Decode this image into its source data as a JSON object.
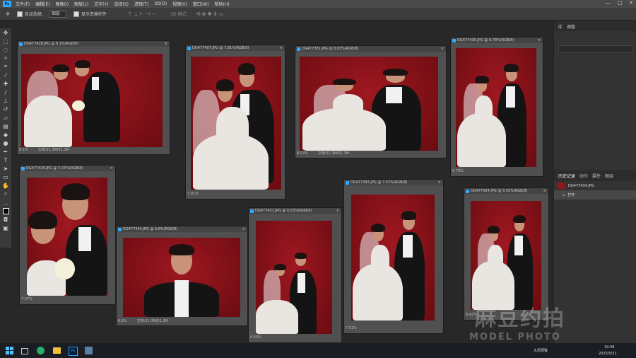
{
  "menubar": {
    "logo": "Ps",
    "items": [
      "文件(F)",
      "编辑(E)",
      "图像(I)",
      "图层(L)",
      "文字(Y)",
      "选择(S)",
      "滤镜(T)",
      "3D(D)",
      "视图(V)",
      "窗口(W)",
      "帮助(H)"
    ],
    "window_controls": [
      "—",
      "□",
      "✕"
    ]
  },
  "options_bar": {
    "auto_select_label": "自动选择：",
    "auto_select_value": "图层",
    "show_transform_label": "显示变换控件",
    "mode_label": "3D 模式："
  },
  "tools": [
    "move-icon",
    "marquee-icon",
    "lasso-icon",
    "magic-wand-icon",
    "crop-icon",
    "eyedropper-icon",
    "healing-icon",
    "brush-icon",
    "stamp-icon",
    "history-brush-icon",
    "eraser-icon",
    "gradient-icon",
    "blur-icon",
    "dodge-icon",
    "pen-icon",
    "type-icon",
    "path-select-icon",
    "rectangle-icon",
    "hand-icon",
    "zoom-icon",
    "more-icon",
    "color-swatch-icon",
    "quickmask-icon",
    "screenmode-icon"
  ],
  "right_panel": {
    "top_tabs": [
      "库",
      "调整"
    ],
    "history_tabs": [
      "历史记录",
      "动作",
      "属性",
      "图层"
    ],
    "history_rows": [
      "DG477434.JPG",
      "打开"
    ]
  },
  "documents": [
    {
      "title": "DG477428.JPG @ 8.1%(RGB/8)",
      "zoom": "8.1%",
      "doc": "文档:51.3M/51.3M"
    },
    {
      "title": "DG477407.JPG @ 7.91%(RGB/8)",
      "zoom": "7.91%",
      "doc": ""
    },
    {
      "title": "DG477381.JPG @ 8.03%(RGB/8)",
      "zoom": "8.03%",
      "doc": "文档:51.3M/51.3M"
    },
    {
      "title": "DG477430.JPG @ 6.78%(RGB/8)",
      "zoom": "6.78%",
      "doc": ""
    },
    {
      "title": "DG477425.JPG @ 7.07%(RGB/8)",
      "zoom": "7.07%",
      "doc": ""
    },
    {
      "title": "DG477434.JPG @ 6.8%(RGB/8)",
      "zoom": "6.8%",
      "doc": "文档:51.3M/51.3M"
    },
    {
      "title": "DG477431.JPG @ 6.63%(RGB/8)",
      "zoom": "6.63%",
      "doc": ""
    },
    {
      "title": "DG477397.JPG @ 7.51%(RGB/8)",
      "zoom": "7.51%",
      "doc": ""
    },
    {
      "title": "DG477424.JPG @ 6.42%(RGB/8)",
      "zoom": "6.42%",
      "doc": ""
    }
  ],
  "watermark": {
    "brand": "麻豆约拍",
    "sub": "MODEL PHOTO"
  },
  "taskbar": {
    "apps": [
      "windows-start-icon",
      "taskview-icon",
      "wechat-icon",
      "file-explorer-icon",
      "photoshop-icon",
      "calculator-icon"
    ],
    "weather": "大风预警",
    "time": "19:48",
    "date": "2023/5/31"
  },
  "colors": {
    "canvas_red": "#8e0f17",
    "ui_dark": "#282828",
    "ps_blue": "#31a8ff"
  }
}
